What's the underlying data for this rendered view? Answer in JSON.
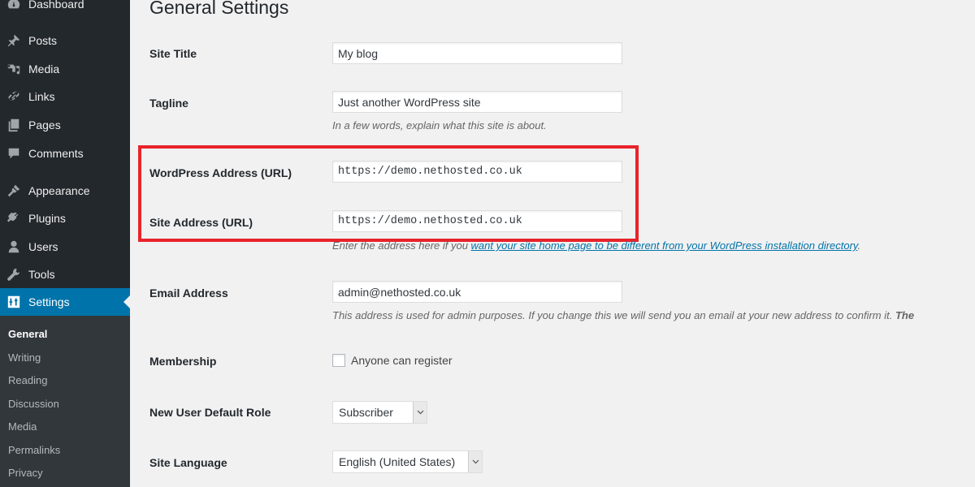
{
  "sidebar": {
    "items": [
      {
        "label": "Dashboard",
        "icon": "dashboard-icon"
      },
      {
        "label": "Posts",
        "icon": "pushpin-icon"
      },
      {
        "label": "Media",
        "icon": "media-icon"
      },
      {
        "label": "Links",
        "icon": "link-icon"
      },
      {
        "label": "Pages",
        "icon": "pages-icon"
      },
      {
        "label": "Comments",
        "icon": "comment-icon"
      },
      {
        "label": "Appearance",
        "icon": "paintbrush-icon"
      },
      {
        "label": "Plugins",
        "icon": "plugin-icon"
      },
      {
        "label": "Users",
        "icon": "user-icon"
      },
      {
        "label": "Tools",
        "icon": "wrench-icon"
      },
      {
        "label": "Settings",
        "icon": "settings-sliders-icon",
        "active": true
      }
    ],
    "submenu": [
      {
        "label": "General",
        "current": true
      },
      {
        "label": "Writing"
      },
      {
        "label": "Reading"
      },
      {
        "label": "Discussion"
      },
      {
        "label": "Media"
      },
      {
        "label": "Permalinks"
      },
      {
        "label": "Privacy"
      }
    ]
  },
  "colors": {
    "sidebar_bg": "#23282d",
    "submenu_bg": "#32373c",
    "accent": "#0073aa",
    "highlight_box": "#e8232a",
    "page_bg": "#f1f1f1"
  },
  "main": {
    "title": "General Settings",
    "fields": {
      "site_title": {
        "label": "Site Title",
        "value": "My blog"
      },
      "tagline": {
        "label": "Tagline",
        "value": "Just another WordPress site",
        "description": "In a few words, explain what this site is about."
      },
      "wp_address": {
        "label": "WordPress Address (URL)",
        "value": "https://demo.nethosted.co.uk"
      },
      "site_address": {
        "label": "Site Address (URL)",
        "value": "https://demo.nethosted.co.uk",
        "description_prefix": "Enter the address here if you ",
        "description_link": "want your site home page to be different from your WordPress installation directory",
        "description_suffix": "."
      },
      "email": {
        "label": "Email Address",
        "value": "admin@nethosted.co.uk",
        "description": "This address is used for admin purposes. If you change this we will send you an email at your new address to confirm it. ",
        "description_bold": "The"
      },
      "membership": {
        "label": "Membership",
        "checkbox_label": "Anyone can register",
        "checked": false
      },
      "default_role": {
        "label": "New User Default Role",
        "selected": "Subscriber"
      },
      "site_language": {
        "label": "Site Language",
        "selected": "English (United States)"
      }
    }
  }
}
